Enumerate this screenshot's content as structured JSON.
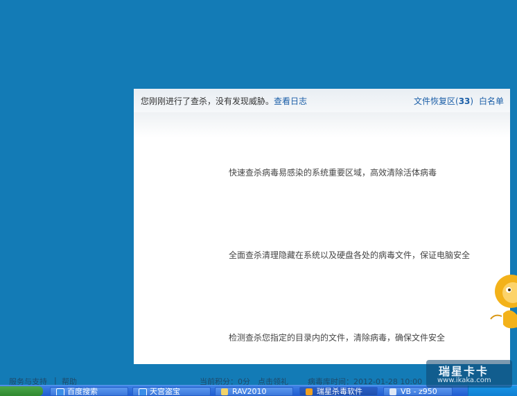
{
  "panel": {
    "scan_message": "您刚刚进行了查杀，没有发现威胁。",
    "view_log_link": "查看日志",
    "recovery_label": "文件恢复区",
    "recovery_open": "(",
    "recovery_count": "33",
    "recovery_close": ")",
    "whitelist_link": "白名单"
  },
  "scan_options": [
    {
      "description": "快速查杀病毒易感染的系统重要区域，高效清除活体病毒"
    },
    {
      "description": "全面查杀清理隐藏在系统以及硬盘各处的病毒文件，保证电脑安全"
    },
    {
      "description": "检测查杀您指定的目录内的文件，清除病毒，确保文件安全"
    }
  ],
  "footer": {
    "support_link": "服务与支持",
    "separator": "|",
    "help_link": "帮助",
    "points_text": "当前积分：0分",
    "points_link": "点击领礼",
    "virus_db_label": "病毒库时间：2012-01-28 10:00"
  },
  "taskbar": {
    "items": [
      {
        "label": "百度搜索",
        "icon": "ie-icon"
      },
      {
        "label": "天宫盗宝",
        "icon": "ie-icon"
      },
      {
        "label": "RAV2010",
        "icon": "folder-icon"
      },
      {
        "label": "瑞星杀毒软件",
        "icon": "rising-icon"
      },
      {
        "label": "VB - z950",
        "icon": "app-icon"
      }
    ]
  },
  "watermark": {
    "title": "瑞星卡卡",
    "url": "www.ikaka.com"
  },
  "colors": {
    "background": "#137bb6",
    "link": "#1c5fa8",
    "panel": "#ffffff"
  }
}
